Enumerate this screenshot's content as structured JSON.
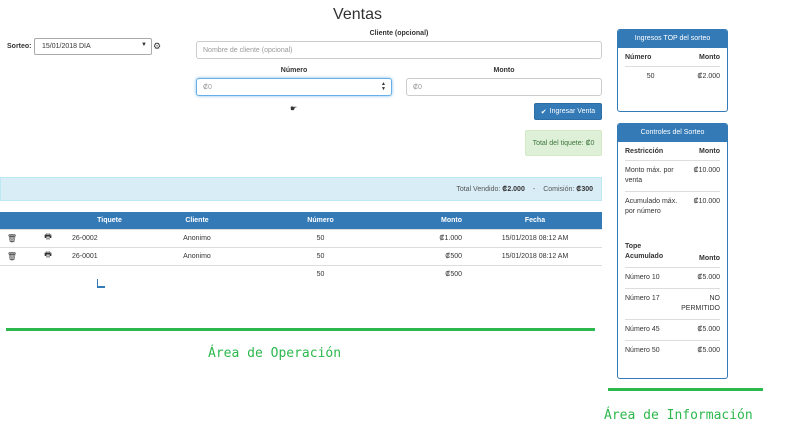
{
  "page_title": "Ventas",
  "sorteo": {
    "label": "Sorteo:",
    "selected": "15/01/2018 DIA"
  },
  "form": {
    "cliente_label": "Cliente (opcional)",
    "cliente_placeholder": "Nombre de cliente (opcional)",
    "numero_label": "Número",
    "numero_placeholder": "₡0",
    "monto_label": "Monto",
    "monto_placeholder": "₡0",
    "submit_label": "Ingresar Venta",
    "total_tiquete": "Total del tiquete: ₡0"
  },
  "summary": {
    "total_vendido_label": "Total Vendido:",
    "total_vendido": "₡2.000",
    "separator": "-",
    "comision_label": "Comisión:",
    "comision": "₡300"
  },
  "sales_table": {
    "headers": [
      "Tiquete",
      "Cliente",
      "Número",
      "Monto",
      "Fecha"
    ],
    "rows": [
      {
        "tiquete": "26-0002",
        "cliente": "Anonimo",
        "numero": "50",
        "monto": "₡1.000",
        "fecha": "15/01/2018 08:12 AM"
      },
      {
        "tiquete": "26-0001",
        "cliente": "Anonimo",
        "numero": "50",
        "monto": "₡500",
        "fecha": "15/01/2018 08:12 AM"
      }
    ],
    "extra_row": {
      "numero": "50",
      "monto": "₡500"
    }
  },
  "annotations": {
    "operacion": "Área de Operación",
    "informacion": "Área de Información"
  },
  "top_panel": {
    "title": "Ingresos TOP del sorteo",
    "headers": [
      "Número",
      "Monto"
    ],
    "rows": [
      {
        "numero": "50",
        "monto": "₡2.000"
      }
    ]
  },
  "controls_panel": {
    "title": "Controles del Sorteo",
    "headers": [
      "Restricción",
      "Monto"
    ],
    "rows": [
      {
        "label": "Monto máx. por venta",
        "value": "₡10.000"
      },
      {
        "label": "Acumulado máx. por número",
        "value": "₡10.000"
      }
    ],
    "tope_headers": [
      "Tope Acumulado",
      "Monto"
    ],
    "tope_rows": [
      {
        "label": "Número 10",
        "value": "₡5.000"
      },
      {
        "label": "Número 17",
        "value": "NO PERMITIDO"
      },
      {
        "label": "Número 45",
        "value": "₡5.000"
      },
      {
        "label": "Número 50",
        "value": "₡5.000"
      }
    ]
  },
  "colors": {
    "primary": "#337ab7",
    "annotation_green": "#2db84d",
    "info_bg": "#d9edf7",
    "success_bg": "#dff0d8"
  }
}
